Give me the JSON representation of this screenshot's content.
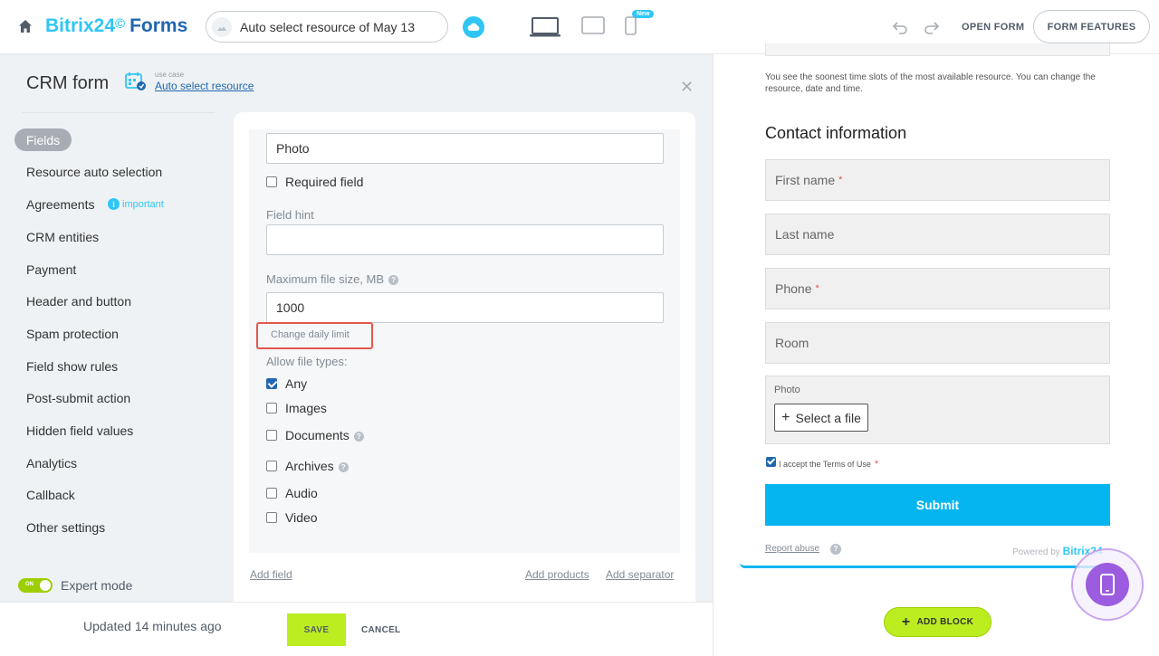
{
  "topbar": {
    "brand_name": "Bitrix24",
    "brand_clock": "©",
    "brand_forms": "Forms",
    "form_title": "Auto select resource of May 13",
    "new_badge": "New",
    "open_form": "OPEN FORM",
    "form_features": "FORM FEATURES"
  },
  "header": {
    "title": "CRM form",
    "usecase_label": "use case",
    "usecase_link": "Auto select resource"
  },
  "nav": {
    "active": "Fields",
    "items": [
      "Resource auto selection",
      "Agreements",
      "CRM entities",
      "Payment",
      "Header and button",
      "Spam protection",
      "Field show rules",
      "Post-submit action",
      "Hidden field values",
      "Analytics",
      "Callback",
      "Other settings"
    ],
    "important": "important",
    "expert_toggle": "ON",
    "expert_mode": "Expert mode"
  },
  "editor": {
    "field_name_value": "Photo",
    "required_field": "Required field",
    "field_hint_label": "Field hint",
    "field_hint_value": "",
    "max_size_label": "Maximum file size, MB",
    "max_size_value": "1000",
    "change_daily_limit": "Change daily limit",
    "allow_types_label": "Allow file types:",
    "types": [
      "Any",
      "Images",
      "Documents",
      "Archives",
      "Audio",
      "Video"
    ],
    "add_field": "Add field",
    "add_products": "Add products",
    "add_separator": "Add separator"
  },
  "bottombar": {
    "updated": "Updated 14 minutes ago",
    "save": "SAVE",
    "cancel": "CANCEL"
  },
  "preview": {
    "note": "You see the soonest time slots of the most available resource. You can change the resource, date and time.",
    "heading": "Contact information",
    "fields": [
      "First name",
      "Last name",
      "Phone",
      "Room"
    ],
    "required_mark": "*",
    "photo_label": "Photo",
    "select_file": "Select a file",
    "terms": "I accept the Terms of Use",
    "submit": "Submit",
    "report_abuse": "Report abuse",
    "powered_by": "Powered by",
    "powered_brand": "Bitrix24",
    "add_block": "ADD BLOCK"
  },
  "colors": {
    "accent_blue": "#2fc6f6",
    "brand_dark_blue": "#2067b0",
    "save_green": "#bbed21",
    "highlight_red": "#e4574c",
    "submit_blue": "#05b5f0",
    "fab_purple": "#9b5ce0"
  }
}
